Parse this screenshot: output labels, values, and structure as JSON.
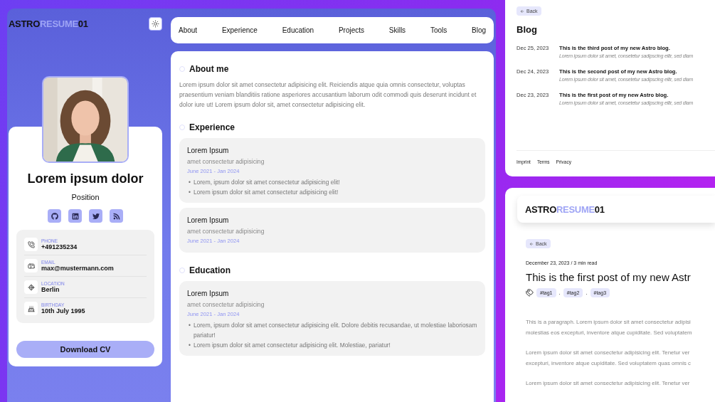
{
  "resume_page": {
    "logo": [
      {
        "text": "ASTRO",
        "accent": false
      },
      {
        "text": "RESUME",
        "accent": true
      },
      {
        "text": "01",
        "accent": false
      }
    ],
    "profile": {
      "name": "Lorem ipsum dolor",
      "position": "Position"
    },
    "contacts": [
      {
        "label": "PHONE",
        "value": "+491235234"
      },
      {
        "label": "EMAIL",
        "value": "max@mustermann.com"
      },
      {
        "label": "LOCATION",
        "value": "Berlin"
      },
      {
        "label": "BIRTHDAY",
        "value": "10th July 1995"
      }
    ],
    "download_button": "Download CV",
    "nav": [
      "About",
      "Experience",
      "Education",
      "Projects",
      "Skills",
      "Tools",
      "Blog"
    ],
    "sections": [
      {
        "kind": "text",
        "title": "About me",
        "text": "Lorem ipsum dolor sit amet consectetur adipisicing elit. Reiciendis atque quia omnis consectetur, voluptas praesentium veniam blanditiis ratione asperiores accusantium laborum odit commodi quis deserunt incidunt et dolor iure ut! Lorem ipsum dolor sit, amet consectetur adipisicing elit."
      },
      {
        "kind": "timeline",
        "title": "Experience",
        "entries": [
          {
            "title": "Lorem Ipsum",
            "subtitle": "amet consectetur adipisicing",
            "dates": "June 2021 - Jan 2024",
            "bullets": [
              {
                "marker": "•",
                "text": "Lorem, ipsum dolor sit amet consectetur adipisicing elit!"
              },
              {
                "marker": "•",
                "text": "Lorem ipsum dolor sit amet consectetur adipisicing elit!"
              }
            ]
          },
          {
            "title": "Lorem Ipsum",
            "subtitle": "amet consectetur adipisicing",
            "dates": "June 2021 - Jan 2024"
          }
        ]
      },
      {
        "kind": "timeline",
        "title": "Education",
        "entries": [
          {
            "title": "Lorem Ipsum",
            "subtitle": "amet consectetur adipisicing",
            "dates": "June 2021 - Jan 2024",
            "bullets": [
              {
                "marker": "•",
                "text": "Lorem, ipsum dolor sit amet consectetur adipisicing elit. Dolore debitis recusandae, ut molestiae laboriosam pariatur!"
              },
              {
                "marker": "•",
                "text": "Lorem ipsum dolor sit amet consectetur adipisicing elit. Molestiae, pariatur!"
              }
            ]
          }
        ]
      }
    ]
  },
  "blog_page": {
    "back": "Back",
    "title": "Blog",
    "posts": [
      {
        "date": "Dec 25, 2023",
        "title": "This is the third post of my new Astro blog.",
        "excerpt": "Lorem ipsum dolor sit amet, consetetur sadipscing elitr, sed diam"
      },
      {
        "date": "Dec 24, 2023",
        "title": "This is the second post of my new Astro blog.",
        "excerpt": "Lorem ipsum dolor sit amet, consetetur sadipscing elitr, sed diam"
      },
      {
        "date": "Dec 23, 2023",
        "title": "This is the first post of my new Astro blog.",
        "excerpt": "Lorem ipsum dolor sit amet, consetetur sadipscing elitr, sed diam"
      }
    ],
    "footer_links": [
      "Imprint",
      "Terms",
      "Privacy"
    ]
  },
  "post_page": {
    "logo": [
      {
        "text": "ASTRO",
        "accent": false
      },
      {
        "text": "RESUME",
        "accent": true
      },
      {
        "text": "01",
        "accent": false
      }
    ],
    "back": "Back",
    "meta": "December 23, 2023 / 3 min read",
    "title": "This is the first post of my new Astr",
    "tags": [
      {
        "kind": "tag",
        "text": "#tag1"
      },
      {
        "kind": "separator",
        "text": "."
      },
      {
        "kind": "tag",
        "text": "#tag2"
      },
      {
        "kind": "separator",
        "text": "."
      },
      {
        "kind": "tag",
        "text": "#tag3"
      }
    ],
    "paragraphs": [
      [
        "This is a paragraph. Lorem ipsum dolor sit amet consectetur adipisi",
        "molestias eos excepturi, inventore atque cupiditate. Sed voluptatem"
      ],
      [
        "Lorem ipsum dolor sit amet consectetur adipisicing elit. Tenetur ver",
        "excepturi, inventore atque cupiditate. Sed voluptatem quas omnis c"
      ],
      [
        "Lorem ipsum dolor sit amet consectetur adipisicing elit. Tenetur ver"
      ]
    ]
  }
}
